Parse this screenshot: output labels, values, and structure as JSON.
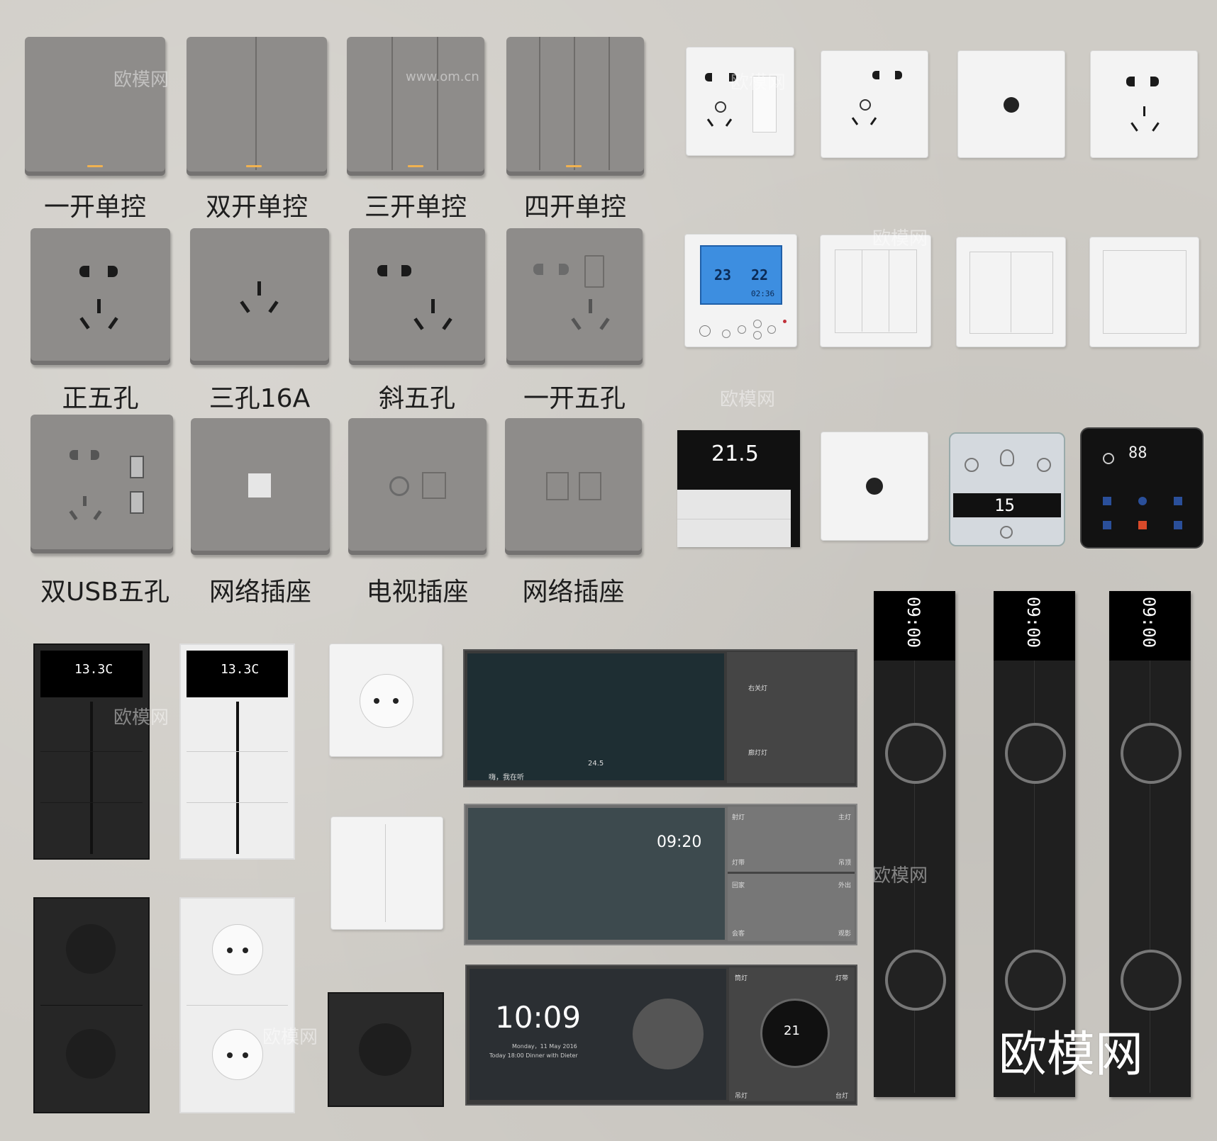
{
  "labels": {
    "row1": [
      "一开单控",
      "双开单控",
      "三开单控",
      "四开单控"
    ],
    "row2": [
      "正五孔",
      "三孔16A",
      "斜五孔",
      "一开五孔"
    ],
    "row3": [
      "双USB五孔",
      "网络插座",
      "电视插座",
      "网络插座"
    ]
  },
  "watermark": {
    "brand": "欧模网",
    "url": "www.om.cn",
    "logo": "欧模网"
  },
  "thermostat_blue": {
    "t1": "23",
    "t2": "22",
    "time": "02:36"
  },
  "thermostat_dark": {
    "temp": "21.5"
  },
  "ac_panel": {
    "temp": "15"
  },
  "black_panel": {
    "temp": "88"
  },
  "knx_panel": {
    "readout": "13.3C"
  },
  "screen1": {
    "left_top": "右关灯",
    "left_bottom": "廊灯灯",
    "status": "嗨，我在听",
    "temp": "24.5"
  },
  "screen2": {
    "time": "09:20",
    "labels": [
      "射灯",
      "主灯",
      "灯带",
      "吊顶",
      "回家",
      "外出",
      "会客",
      "观影"
    ]
  },
  "screen3": {
    "time": "10:09",
    "date": "Monday，11 May 2016",
    "agenda": "Today 18:00  Dinner with Dieter",
    "dial": "21",
    "labels": [
      "筒灯",
      "灯带",
      "吊灯",
      "台灯"
    ]
  },
  "strips": {
    "time": "09:00"
  },
  "colors": {
    "gray": "#8e8c8a",
    "led": "#f0b250",
    "white": "#f3f3f3",
    "dark": "#262626",
    "lcd": "#3d8ee0"
  }
}
